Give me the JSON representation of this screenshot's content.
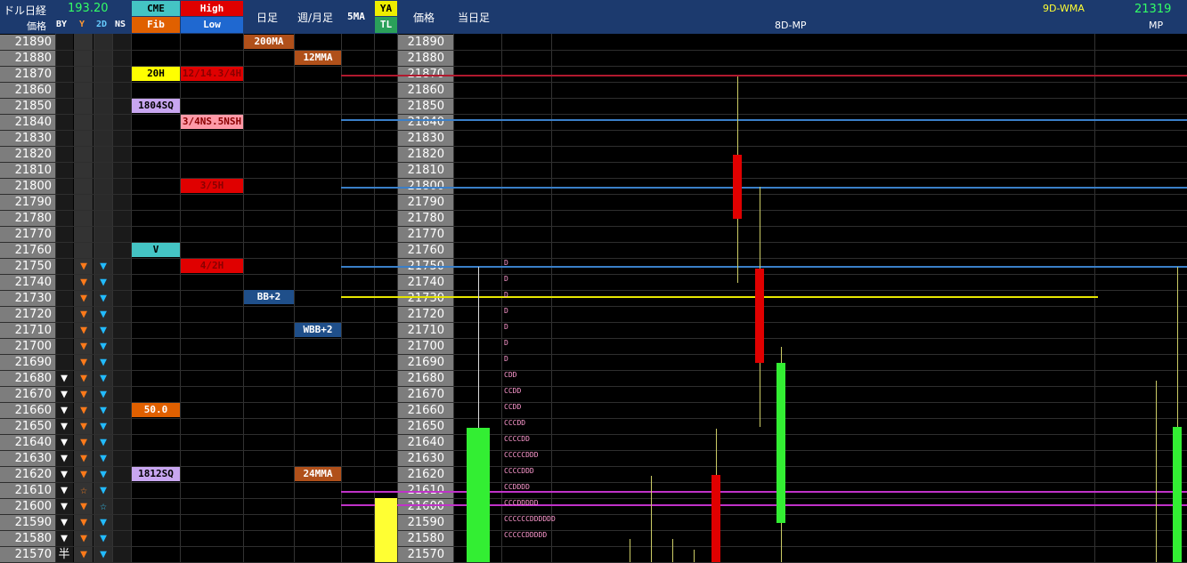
{
  "header": {
    "pair_label": "ドル日経",
    "pair_value": "193.20",
    "price_label": "価格",
    "by_label": "BY",
    "y_label": "Y",
    "d2_label": "2D",
    "ns_label": "NS",
    "cme_label": "CME",
    "fib_label": "Fib",
    "high_label": "High",
    "low_label": "Low",
    "daily_label": "日足",
    "weekly_label": "週/月足",
    "ma5_label": "5MA",
    "ya_label": "YA",
    "tl_label": "TL",
    "price_label2": "価格",
    "today_label": "当日足",
    "mp_title": "8D-MP",
    "wma_label": "9D-WMA",
    "wma_value": "21319",
    "mp_label": "MP"
  },
  "prices": [
    "21890",
    "21880",
    "21870",
    "21860",
    "21850",
    "21840",
    "21830",
    "21820",
    "21810",
    "21800",
    "21790",
    "21780",
    "21770",
    "21760",
    "21750",
    "21740",
    "21730",
    "21720",
    "21710",
    "21700",
    "21690",
    "21680",
    "21670",
    "21660",
    "21650",
    "21640",
    "21630",
    "21620",
    "21610",
    "21600",
    "21590",
    "21580",
    "21570"
  ],
  "tags": {
    "ma200": "200MA",
    "mma12": "12MMA",
    "h20": "20H",
    "hi_1214": "12/14.3/4H",
    "sq1804": "1804SQ",
    "ns_38": "3/4NS.5NSH",
    "h35": "3/5H",
    "v": "V",
    "h42": "4/2H",
    "bb2": "BB+2",
    "wbb2": "WBB+2",
    "fib50": "50.0",
    "sq1812": "1812SQ",
    "mma24": "24MMA"
  },
  "marks": {
    "down_white": "▼",
    "down_orange": "▼",
    "down_cyan": "▼",
    "star_orange": "☆",
    "star_cyan": "☆",
    "half": "半"
  },
  "tpo_rows": [
    "D",
    "D",
    "D",
    "D",
    "D",
    "D",
    "D",
    "CDD",
    "CCDD",
    "CCDD",
    "CCCDD",
    "CCCCDD",
    "CCCCCDDD",
    "CCCCDDD",
    "CCDDDD",
    "CCCDDDDD",
    "CCCCCCDDDDDD",
    "CCCCCDDDDD"
  ],
  "colors": {
    "header_bg": "#1c3a6e",
    "price_bg": "#7d7d7d",
    "red_line": "#b0192e",
    "blue_line": "#3a7fc8",
    "yellow_line": "#e6e600",
    "magenta_line": "#c032c8",
    "candle_red": "#e00000",
    "candle_green": "#33ee33"
  }
}
